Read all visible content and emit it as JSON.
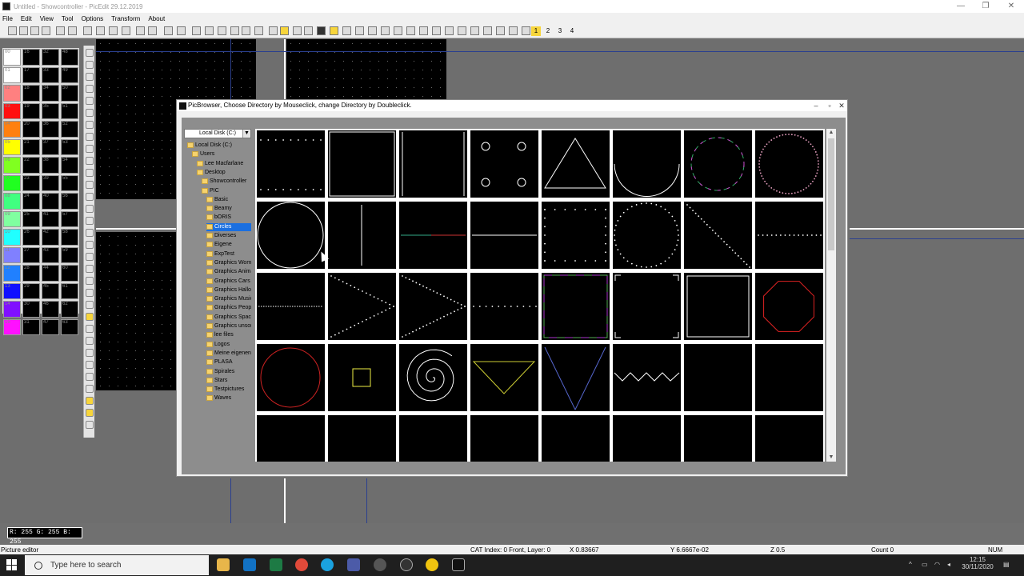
{
  "window": {
    "title": "Untitled - Showcontroller - PicEdit 29.12.2019",
    "controls": [
      "—",
      "❐",
      "✕"
    ]
  },
  "menu": [
    "File",
    "Edit",
    "View",
    "Tool",
    "Options",
    "Transform",
    "About"
  ],
  "toolbar": {
    "layers": [
      "1",
      "2",
      "3",
      "4"
    ]
  },
  "palette": [
    {
      "n": "00",
      "c": "#ffffff"
    },
    {
      "n": "16",
      "c": "#000000"
    },
    {
      "n": "32",
      "c": "#000000"
    },
    {
      "n": "48",
      "c": "#000000"
    },
    {
      "n": "01",
      "c": "#ffffff"
    },
    {
      "n": "17",
      "c": "#000000"
    },
    {
      "n": "33",
      "c": "#000000"
    },
    {
      "n": "49",
      "c": "#000000"
    },
    {
      "n": "02",
      "c": "#ff8080"
    },
    {
      "n": "18",
      "c": "#000000"
    },
    {
      "n": "34",
      "c": "#000000"
    },
    {
      "n": "50",
      "c": "#000000"
    },
    {
      "n": "03",
      "c": "#ff1010"
    },
    {
      "n": "19",
      "c": "#000000"
    },
    {
      "n": "35",
      "c": "#000000"
    },
    {
      "n": "51",
      "c": "#000000"
    },
    {
      "n": "04",
      "c": "#ff8010"
    },
    {
      "n": "20",
      "c": "#000000"
    },
    {
      "n": "36",
      "c": "#000000"
    },
    {
      "n": "52",
      "c": "#000000"
    },
    {
      "n": "05",
      "c": "#ffff00"
    },
    {
      "n": "21",
      "c": "#000000"
    },
    {
      "n": "37",
      "c": "#000000"
    },
    {
      "n": "53",
      "c": "#000000"
    },
    {
      "n": "06",
      "c": "#80ff20"
    },
    {
      "n": "22",
      "c": "#000000"
    },
    {
      "n": "38",
      "c": "#000000"
    },
    {
      "n": "54",
      "c": "#000000"
    },
    {
      "n": "07",
      "c": "#20ff20"
    },
    {
      "n": "23",
      "c": "#000000"
    },
    {
      "n": "39",
      "c": "#000000"
    },
    {
      "n": "55",
      "c": "#000000"
    },
    {
      "n": "08",
      "c": "#40ff80"
    },
    {
      "n": "24",
      "c": "#000000"
    },
    {
      "n": "40",
      "c": "#000000"
    },
    {
      "n": "56",
      "c": "#000000"
    },
    {
      "n": "09",
      "c": "#80ffa0"
    },
    {
      "n": "25",
      "c": "#000000"
    },
    {
      "n": "41",
      "c": "#000000"
    },
    {
      "n": "57",
      "c": "#000000"
    },
    {
      "n": "10",
      "c": "#20ffff"
    },
    {
      "n": "26",
      "c": "#000000"
    },
    {
      "n": "42",
      "c": "#000000"
    },
    {
      "n": "58",
      "c": "#000000"
    },
    {
      "n": "11",
      "c": "#8080ff"
    },
    {
      "n": "27",
      "c": "#000000"
    },
    {
      "n": "43",
      "c": "#000000"
    },
    {
      "n": "59",
      "c": "#000000"
    },
    {
      "n": "12",
      "c": "#2080ff"
    },
    {
      "n": "28",
      "c": "#000000"
    },
    {
      "n": "44",
      "c": "#000000"
    },
    {
      "n": "60",
      "c": "#000000"
    },
    {
      "n": "13",
      "c": "#1010ff"
    },
    {
      "n": "29",
      "c": "#000000"
    },
    {
      "n": "45",
      "c": "#000000"
    },
    {
      "n": "61",
      "c": "#000000"
    },
    {
      "n": "14",
      "c": "#8010ff"
    },
    {
      "n": "30",
      "c": "#000000"
    },
    {
      "n": "46",
      "c": "#000000"
    },
    {
      "n": "62",
      "c": "#000000"
    },
    {
      "n": "15",
      "c": "#ff10ff"
    },
    {
      "n": "31",
      "c": "#000000"
    },
    {
      "n": "47",
      "c": "#000000"
    },
    {
      "n": "63",
      "c": "#000000"
    }
  ],
  "color_readout": "R: 255 G: 255 B: 255",
  "dialog": {
    "title": "PicBrowser, Choose Directory by Mouseclick, change Directory by Doubleclick.",
    "drive": "Local Disk (C:)",
    "tree": [
      {
        "label": "Local Disk (C:)",
        "indent": 0
      },
      {
        "label": "Users",
        "indent": 1
      },
      {
        "label": "Lee Macfarlane",
        "indent": 2
      },
      {
        "label": "Desktop",
        "indent": 2
      },
      {
        "label": "Showcontroller",
        "indent": 3
      },
      {
        "label": "PIC",
        "indent": 3
      },
      {
        "label": "Basic",
        "indent": 4
      },
      {
        "label": "Beamy",
        "indent": 4
      },
      {
        "label": "bORIS",
        "indent": 4
      },
      {
        "label": "Circles",
        "indent": 4,
        "selected": true
      },
      {
        "label": "Diverses",
        "indent": 4
      },
      {
        "label": "Eigene",
        "indent": 4
      },
      {
        "label": "ExpTest",
        "indent": 4
      },
      {
        "label": "Graphics Wome",
        "indent": 4
      },
      {
        "label": "Graphics Anima",
        "indent": 4
      },
      {
        "label": "Graphics Cars",
        "indent": 4
      },
      {
        "label": "Graphics Hallov",
        "indent": 4
      },
      {
        "label": "Graphics Music",
        "indent": 4
      },
      {
        "label": "Graphics People",
        "indent": 4
      },
      {
        "label": "Graphics Space",
        "indent": 4
      },
      {
        "label": "Graphics unsort",
        "indent": 4
      },
      {
        "label": "lee files",
        "indent": 4
      },
      {
        "label": "Logos",
        "indent": 4
      },
      {
        "label": "Meine eigenen",
        "indent": 4
      },
      {
        "label": "PLASA",
        "indent": 4
      },
      {
        "label": "Spirales",
        "indent": 4
      },
      {
        "label": "Stars",
        "indent": 4
      },
      {
        "label": "Testpictures",
        "indent": 4
      },
      {
        "label": "Waves",
        "indent": 4
      }
    ]
  },
  "status": {
    "left": "Picture editor",
    "cat": "CAT Index: 0 Front, Layer: 0",
    "x": "X 0.83667",
    "y": "Y 6.6667e-02",
    "z": "Z 0.5",
    "count": "Count 0",
    "num": "NUM"
  },
  "taskbar": {
    "search_placeholder": "Type here to search",
    "time": "12:15",
    "date": "30/11/2020"
  }
}
